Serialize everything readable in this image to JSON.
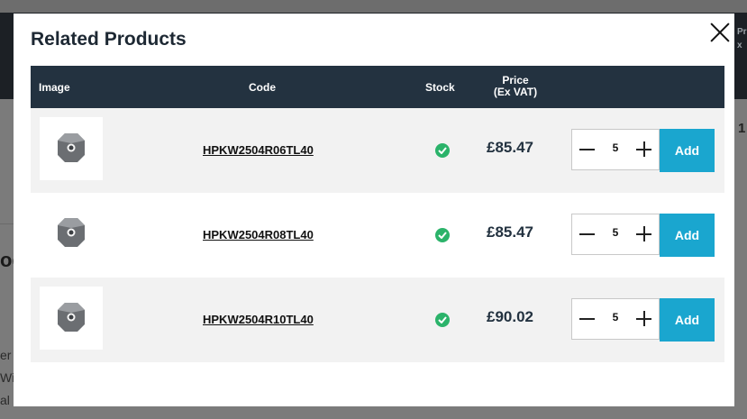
{
  "background": {
    "right_text_1": "Pr",
    "right_text_2": "x",
    "right_number": "1",
    "left_heading": "od",
    "left_text_1": "er r",
    "left_text_2": "Wi",
    "left_text_3": "al a"
  },
  "modal": {
    "title": "Related Products",
    "columns": {
      "image": "Image",
      "code": "Code",
      "stock": "Stock",
      "price_line1": "Price",
      "price_line2": "(Ex VAT)"
    },
    "add_label": "Add",
    "products": [
      {
        "code": "HPKW2504R06TL40",
        "price": "£85.47",
        "qty": "5",
        "in_stock": true
      },
      {
        "code": "HPKW2504R08TL40",
        "price": "£85.47",
        "qty": "5",
        "in_stock": true
      },
      {
        "code": "HPKW2504R10TL40",
        "price": "£90.02",
        "qty": "5",
        "in_stock": true
      }
    ]
  },
  "colors": {
    "header_bg": "#233240",
    "accent": "#1aa6cf",
    "stock_ok": "#2bb36a"
  },
  "icons": [
    "close-icon",
    "product-insert-icon",
    "checkmark-icon",
    "minus-icon",
    "plus-icon"
  ]
}
